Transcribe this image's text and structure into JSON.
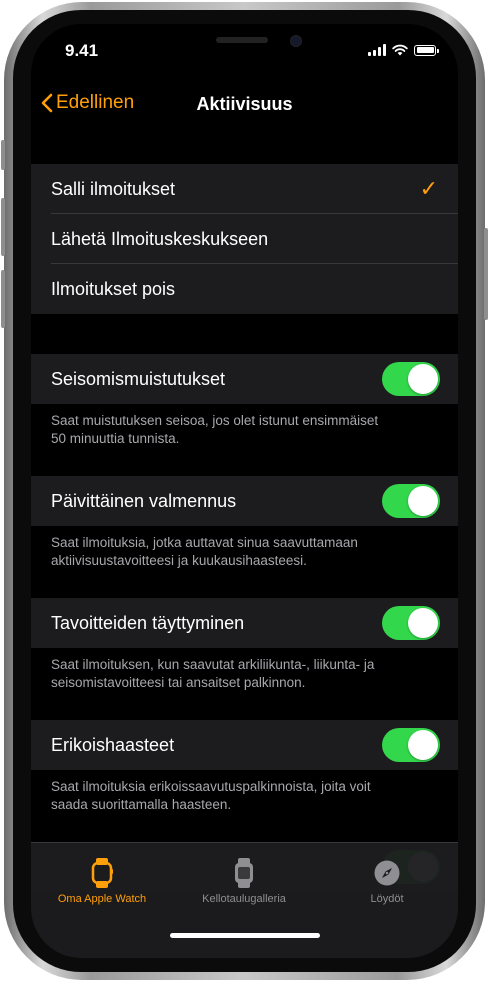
{
  "status": {
    "time": "9.41"
  },
  "nav": {
    "back_label": "Edellinen",
    "title": "Aktiivisuus"
  },
  "alert_options": [
    {
      "label": "Salli ilmoitukset",
      "selected": true
    },
    {
      "label": "Lähetä Ilmoituskeskukseen",
      "selected": false
    },
    {
      "label": "Ilmoitukset pois",
      "selected": false
    }
  ],
  "settings": [
    {
      "label": "Seisomismuistutukset",
      "on": true,
      "footer_lines": [
        "Saat muistutuksen seisoa, jos olet istunut ensimmäiset",
        "50 minuuttia tunnista."
      ]
    },
    {
      "label": "Päivittäinen valmennus",
      "on": true,
      "footer_lines": [
        "Saat ilmoituksia, jotka auttavat sinua saavuttamaan",
        "aktiivisuustavoitteesi ja kuukausihaasteesi."
      ]
    },
    {
      "label": "Tavoitteiden täyttyminen",
      "on": true,
      "footer_lines": [
        "Saat ilmoituksen, kun saavutat arkiliikunta-, liikunta- ja",
        "seisomistavoitteesi tai ansaitset palkinnon."
      ]
    },
    {
      "label": "Erikoishaasteet",
      "on": true,
      "footer_lines": [
        "Saat ilmoituksia erikoissaavutuspalkinnoista, joita voit",
        "saada suorittamalla haasteen."
      ]
    }
  ],
  "tabbar": {
    "tabs": [
      {
        "label": "Oma Apple Watch",
        "icon": "watch-icon",
        "active": true
      },
      {
        "label": "Kellotaulugalleria",
        "icon": "watch-face-gallery-icon",
        "active": false
      },
      {
        "label": "Löydöt",
        "icon": "compass-icon",
        "active": false
      }
    ]
  },
  "colors": {
    "accent": "#ff9f0a",
    "toggle_on": "#32d74b",
    "cell_bg": "#1c1c1e",
    "background": "#000000",
    "footer_text": "#a8a8ad",
    "inactive_tab": "#8e8e93"
  }
}
